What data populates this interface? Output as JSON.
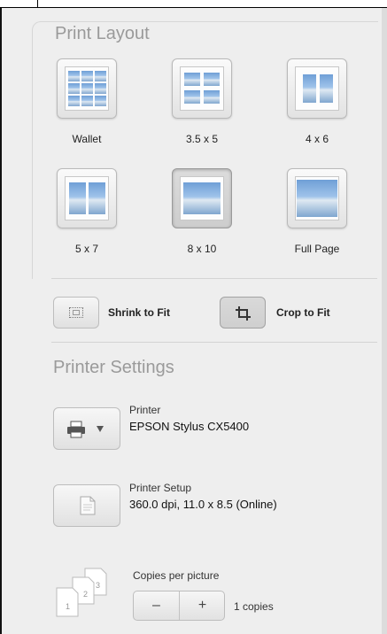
{
  "print_layout": {
    "title": "Print Layout",
    "options": [
      {
        "label": "Wallet",
        "selected": false
      },
      {
        "label": "3.5 x 5",
        "selected": false
      },
      {
        "label": "4 x 6",
        "selected": false
      },
      {
        "label": "5 x 7",
        "selected": false
      },
      {
        "label": "8 x 10",
        "selected": true
      },
      {
        "label": "Full Page",
        "selected": false
      }
    ],
    "fit_options": [
      {
        "label": "Shrink to Fit",
        "icon": "shrink-to-fit-icon",
        "selected": false
      },
      {
        "label": "Crop to Fit",
        "icon": "crop-icon",
        "selected": true
      }
    ]
  },
  "printer_settings": {
    "title": "Printer Settings",
    "printer": {
      "label": "Printer",
      "value": "EPSON Stylus CX5400",
      "icon": "printer-icon"
    },
    "setup": {
      "label": "Printer Setup",
      "value": "360.0 dpi, 11.0 x 8.5 (Online)",
      "icon": "document-icon"
    },
    "copies": {
      "label": "Copies per picture",
      "value": "1 copies",
      "minus": "–",
      "plus": "+",
      "icon": "copies-stack-icon"
    }
  },
  "colors": {
    "panel_bg": "#eeeeee",
    "section_title": "#9a9a9a",
    "photo_sky": "#6f9fd6"
  }
}
